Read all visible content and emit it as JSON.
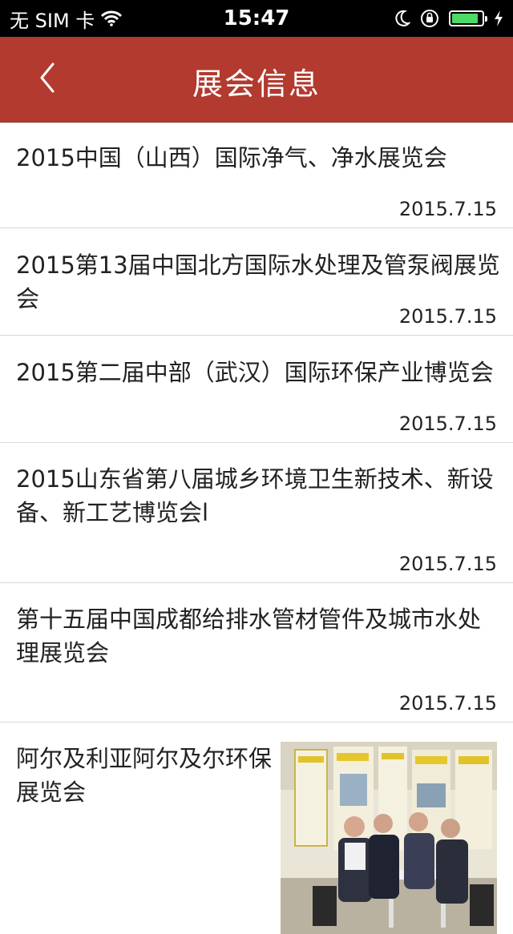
{
  "status_bar": {
    "carrier": "无 SIM 卡",
    "time": "15:47",
    "battery_level": 0.9,
    "icons": [
      "wifi-icon",
      "moon-icon",
      "orientation-lock-icon",
      "battery-icon",
      "charging-icon"
    ]
  },
  "nav": {
    "title": "展会信息",
    "back_icon": "chevron-left-icon"
  },
  "items": [
    {
      "title": "2015中国（山西）国际净气、净水展览会",
      "date": "2015.7.15"
    },
    {
      "title": "2015第13届中国北方国际水处理及管泵阀展览会",
      "date": "2015.7.15"
    },
    {
      "title": "2015第二届中部（武汉）国际环保产业博览会",
      "date": "2015.7.15"
    },
    {
      "title": "2015山东省第八届城乡环境卫生新技术、新设备、新工艺博览会l",
      "date": "2015.7.15"
    },
    {
      "title": "第十五届中国成都给排水管材管件及城市水处理展览会",
      "date": "2015.7.15"
    },
    {
      "title": "阿尔及利亚阿尔及尔环保展览会",
      "has_photo": true
    }
  ],
  "colors": {
    "nav_bg": "#b23a2e",
    "status_bg": "#000000",
    "battery_green": "#4cd964",
    "divider": "#d9d9d9"
  }
}
